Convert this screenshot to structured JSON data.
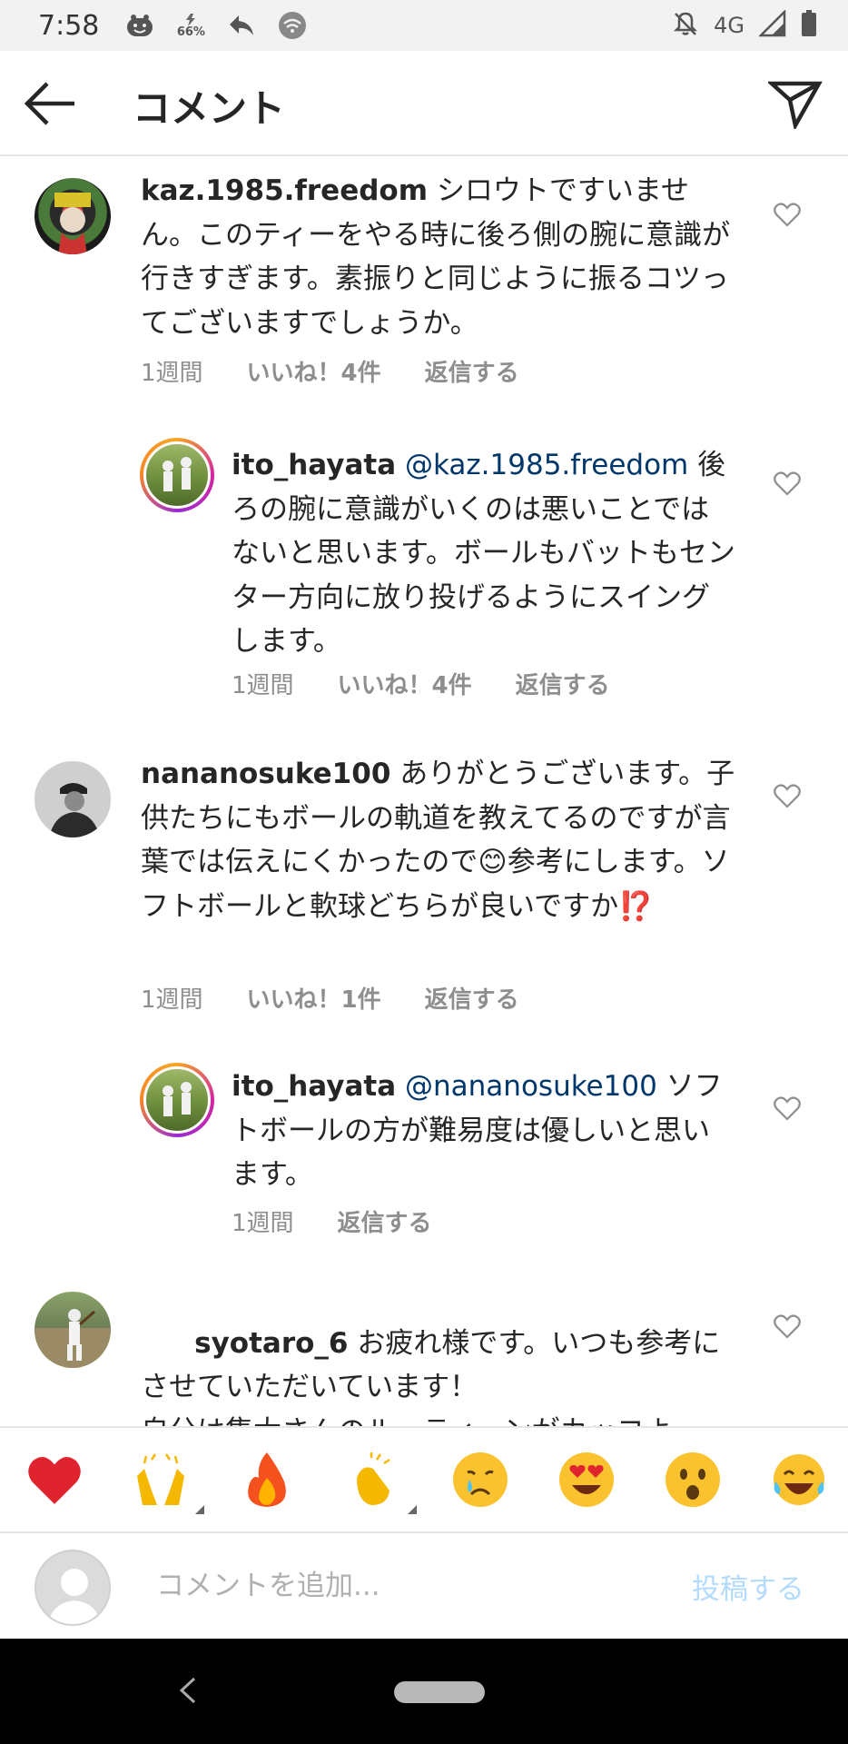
{
  "status_bar": {
    "time": "7:58",
    "battery_label": "66%",
    "network": "4G",
    "left_icons": [
      "face-icon",
      "battery-saver-icon",
      "reply-icon",
      "wifi-icon"
    ],
    "right_icons": [
      "silent-icon",
      "network-4g",
      "signal-icon",
      "battery-icon"
    ]
  },
  "header": {
    "title": "コメント",
    "back_icon": "arrow-left-icon",
    "share_icon": "paper-plane-icon"
  },
  "comments": [
    {
      "username": "kaz.1985.freedom",
      "mention": "",
      "text": " シロウトですいません。このティーをやる時に後ろ側の腕に意識が行きすぎます。素振りと同じように振るコツってございますでしょうか。",
      "time": "1週間",
      "likes": "いいね！4件",
      "reply": "返信する",
      "is_reply": false
    },
    {
      "username": "ito_hayata",
      "mention": " @kaz.1985.freedom",
      "text": " 後ろの腕に意識がいくのは悪いことではないと思います。ボールもバットもセンター方向に放り投げるようにスイングします。",
      "time": "1週間",
      "likes": "いいね！4件",
      "reply": "返信する",
      "is_reply": true
    },
    {
      "username": "nananosuke100",
      "mention": "",
      "text": " ありがとうございます。子供たちにもボールの軌道を教えてるのですが言葉では伝えにくかったので😊参考にします。ソフトボールと軟球どちらが良いですか⁉️",
      "time": "1週間",
      "likes": "いいね！1件",
      "reply": "返信する",
      "is_reply": false
    },
    {
      "username": "ito_hayata",
      "mention": " @nananosuke100",
      "text": " ソフトボールの方が難易度は優しいと思います。",
      "time": "1週間",
      "likes": "",
      "reply": "返信する",
      "is_reply": true
    },
    {
      "username": "syotaro_6",
      "mention": "",
      "text": " お疲れ様です。いつも参考にさせていただいています！\n自分は隼太さんのルーティーンがカッコよ",
      "time": "",
      "likes": "",
      "reply": "",
      "is_reply": false
    }
  ],
  "reactions": [
    "❤️",
    "🙌",
    "🔥",
    "👏",
    "😢",
    "😍",
    "😮",
    "😂"
  ],
  "input": {
    "placeholder": "コメントを追加...",
    "post_label": "投稿する"
  },
  "colors": {
    "text": "#262626",
    "meta": "#8e8e8e",
    "mention": "#00376b",
    "post_disabled": "#b3dbff",
    "heart_red": "#ed4956"
  }
}
